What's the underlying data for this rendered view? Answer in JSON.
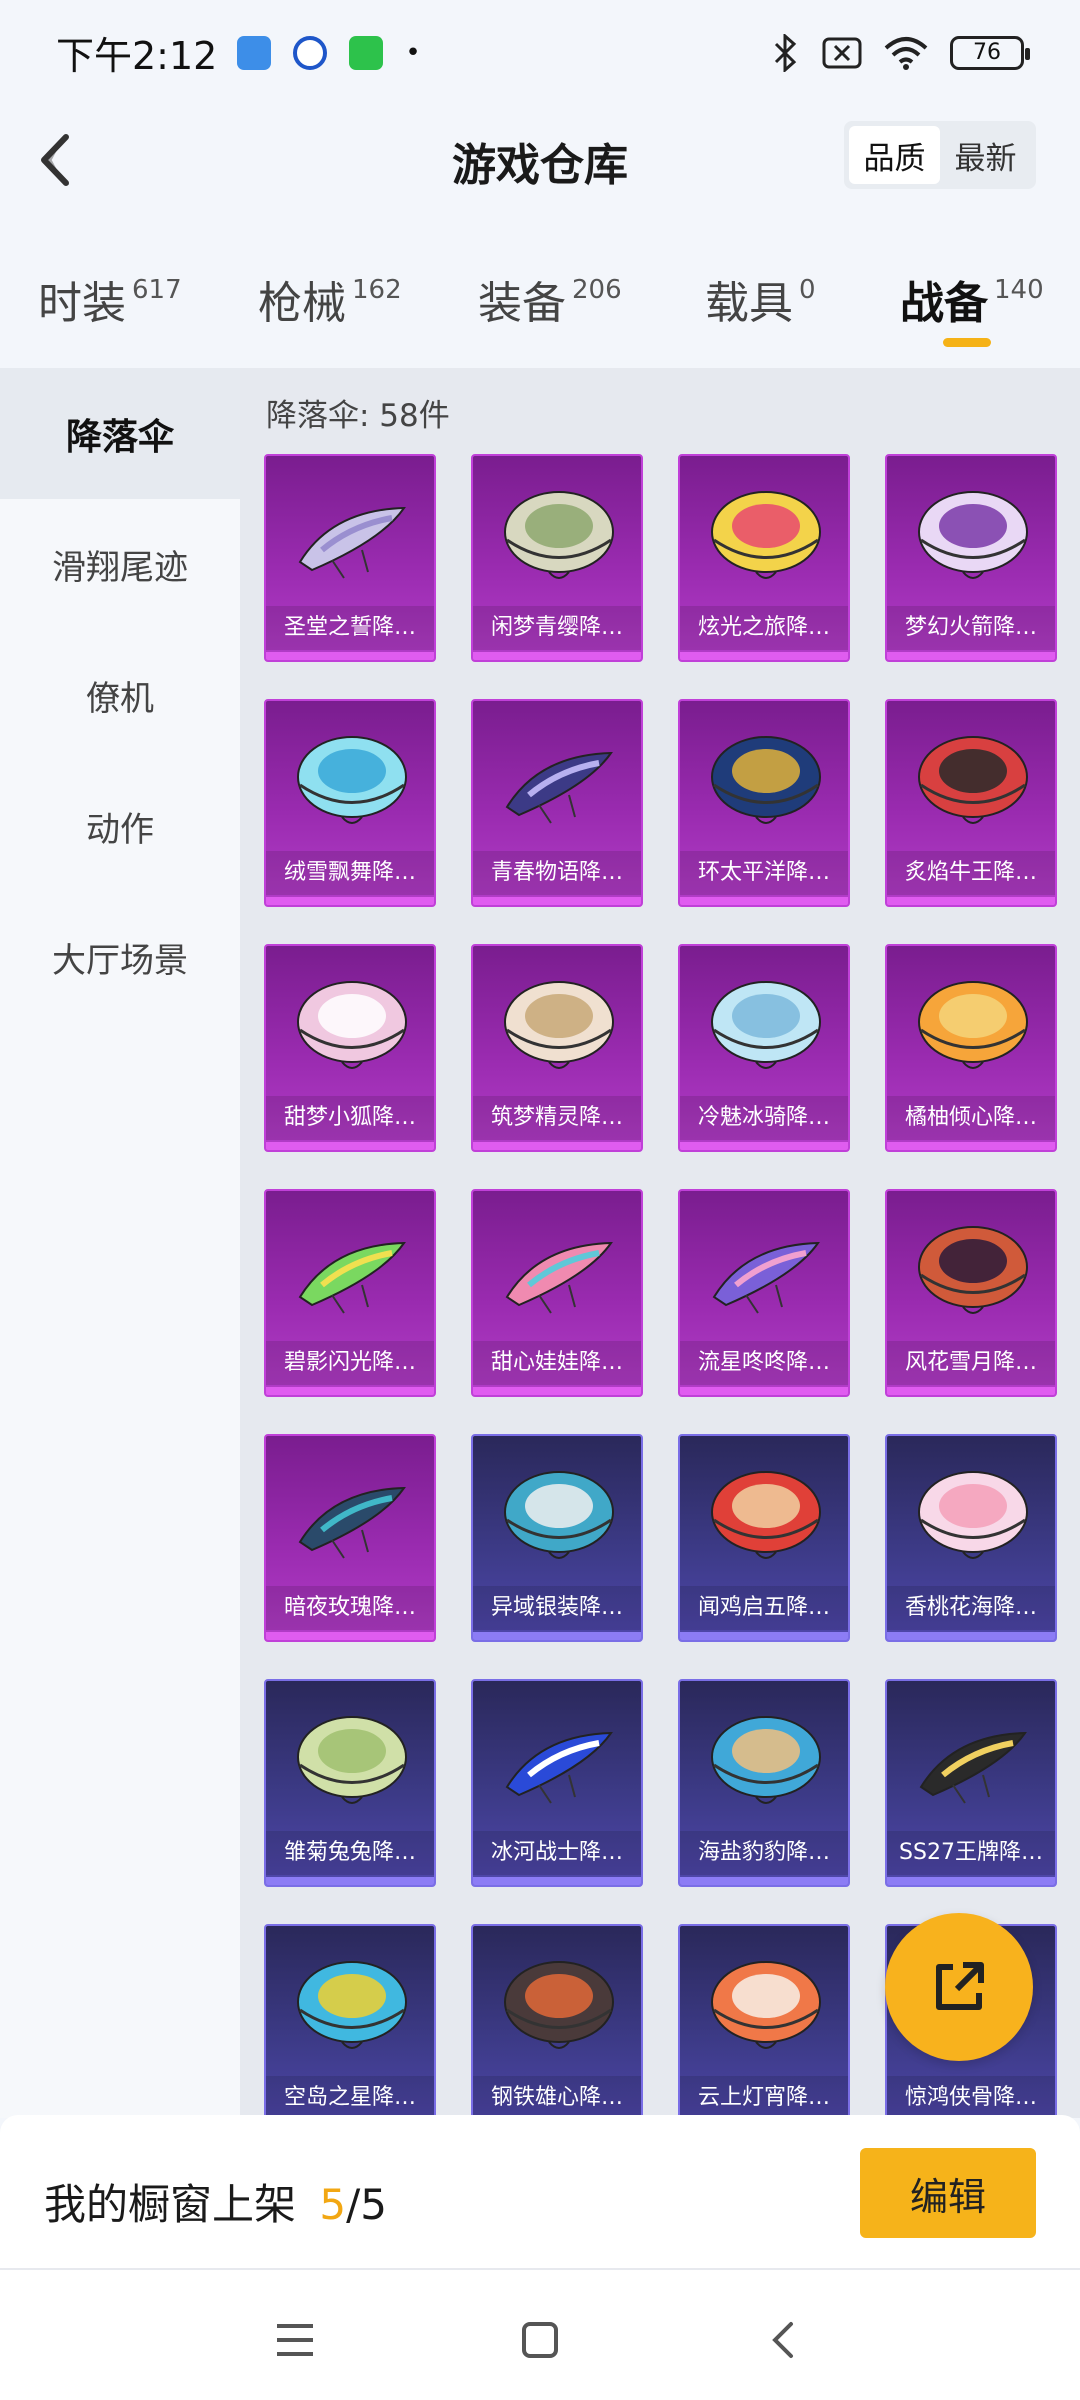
{
  "status_bar": {
    "time": "下午2:12",
    "battery": "76",
    "dot": "•"
  },
  "header": {
    "title": "游戏仓库",
    "sort_options": [
      "品质",
      "最新"
    ],
    "active_sort": "品质"
  },
  "tabs": [
    {
      "label": "时装",
      "count": "617"
    },
    {
      "label": "枪械",
      "count": "162"
    },
    {
      "label": "装备",
      "count": "206"
    },
    {
      "label": "载具",
      "count": "0"
    },
    {
      "label": "战备",
      "count": "140"
    }
  ],
  "active_tab": "战备",
  "sidebar": {
    "items": [
      "降落伞",
      "滑翔尾迹",
      "僚机",
      "动作",
      "大厅场景"
    ],
    "active": "降落伞"
  },
  "content": {
    "count_label": "降落伞: 58件",
    "items": [
      {
        "name": "圣堂之誓降…",
        "rarity": "purple"
      },
      {
        "name": "闲梦青缨降…",
        "rarity": "purple"
      },
      {
        "name": "炫光之旅降…",
        "rarity": "purple"
      },
      {
        "name": "梦幻火箭降…",
        "rarity": "purple"
      },
      {
        "name": "绒雪飘舞降…",
        "rarity": "purple"
      },
      {
        "name": "青春物语降…",
        "rarity": "purple"
      },
      {
        "name": "环太平洋降…",
        "rarity": "purple"
      },
      {
        "name": "炙焰牛王降…",
        "rarity": "purple"
      },
      {
        "name": "甜梦小狐降…",
        "rarity": "purple"
      },
      {
        "name": "筑梦精灵降…",
        "rarity": "purple"
      },
      {
        "name": "冷魅冰骑降…",
        "rarity": "purple"
      },
      {
        "name": "橘柚倾心降…",
        "rarity": "purple"
      },
      {
        "name": "碧影闪光降…",
        "rarity": "purple"
      },
      {
        "name": "甜心娃娃降…",
        "rarity": "purple"
      },
      {
        "name": "流星咚咚降…",
        "rarity": "purple"
      },
      {
        "name": "风花雪月降…",
        "rarity": "purple"
      },
      {
        "name": "暗夜玫瑰降…",
        "rarity": "purple"
      },
      {
        "name": "异域银装降…",
        "rarity": "blue"
      },
      {
        "name": "闻鸡启五降…",
        "rarity": "blue"
      },
      {
        "name": "香桃花海降…",
        "rarity": "blue"
      },
      {
        "name": "雏菊兔兔降…",
        "rarity": "blue"
      },
      {
        "name": "冰河战士降…",
        "rarity": "blue"
      },
      {
        "name": "海盐豹豹降…",
        "rarity": "blue"
      },
      {
        "name": "SS27王牌降…",
        "rarity": "blue"
      },
      {
        "name": "空岛之星降…",
        "rarity": "blue"
      },
      {
        "name": "钢铁雄心降…",
        "rarity": "blue"
      },
      {
        "name": "云上灯宵降…",
        "rarity": "blue"
      },
      {
        "name": "惊鸿侠骨降…",
        "rarity": "blue"
      }
    ]
  },
  "bottom_bar": {
    "showcase_label": "我的橱窗上架",
    "showcase_current": "5",
    "showcase_total": "/5",
    "edit_label": "编辑"
  },
  "colors": {
    "accent": "#f6b31a",
    "purple_card": "#9a2bb0",
    "blue_card": "#3c3a86"
  }
}
